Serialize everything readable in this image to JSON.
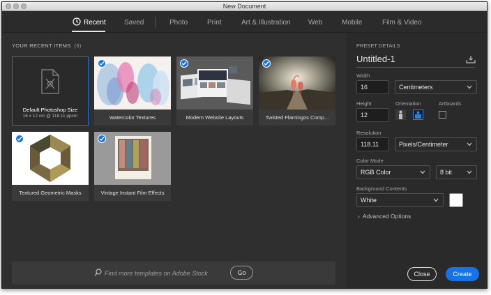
{
  "window": {
    "title": "New Document"
  },
  "tabs": [
    {
      "label": "Recent",
      "active": true
    },
    {
      "label": "Saved"
    },
    {
      "label": "Photo"
    },
    {
      "label": "Print"
    },
    {
      "label": "Art & Illustration"
    },
    {
      "label": "Web"
    },
    {
      "label": "Mobile"
    },
    {
      "label": "Film & Video"
    }
  ],
  "recent": {
    "heading": "YOUR RECENT ITEMS",
    "count": "(6)",
    "items": [
      {
        "title": "Default Photoshop Size",
        "subtitle": "16 x 12 cm @ 118.11 ppcm",
        "icon": "blank-document-icon",
        "selected": true
      },
      {
        "title": "Watercolor Textures",
        "checked": true
      },
      {
        "title": "Modern Website Layouts",
        "checked": true
      },
      {
        "title": "Twisted Flamingos Comp...",
        "checked": true
      },
      {
        "title": "Textured Geometric Masks",
        "checked": true
      },
      {
        "title": "Vintage Instant Film Effects",
        "checked": true
      }
    ]
  },
  "search": {
    "placeholder": "Find more templates on Adobe Stock",
    "go_label": "Go",
    "icon": "search-icon"
  },
  "preset": {
    "heading": "PRESET DETAILS",
    "name": "Untitled-1",
    "width_label": "Width",
    "width_value": "16",
    "width_unit": "Centimeters",
    "height_label": "Height",
    "height_value": "12",
    "orientation_label": "Orientation",
    "artboards_label": "Artboards",
    "resolution_label": "Resolution",
    "resolution_value": "118.11",
    "resolution_unit": "Pixels/Centimeter",
    "color_mode_label": "Color Mode",
    "color_mode": "RGB Color",
    "bit_depth": "8 bit",
    "background_label": "Background Contents",
    "background": "White",
    "advanced_label": "Advanced Options",
    "close_label": "Close",
    "create_label": "Create"
  },
  "colors": {
    "accent": "#1473e6",
    "panel": "#2a2a2a",
    "grid_bg": "#2f2f2f"
  }
}
